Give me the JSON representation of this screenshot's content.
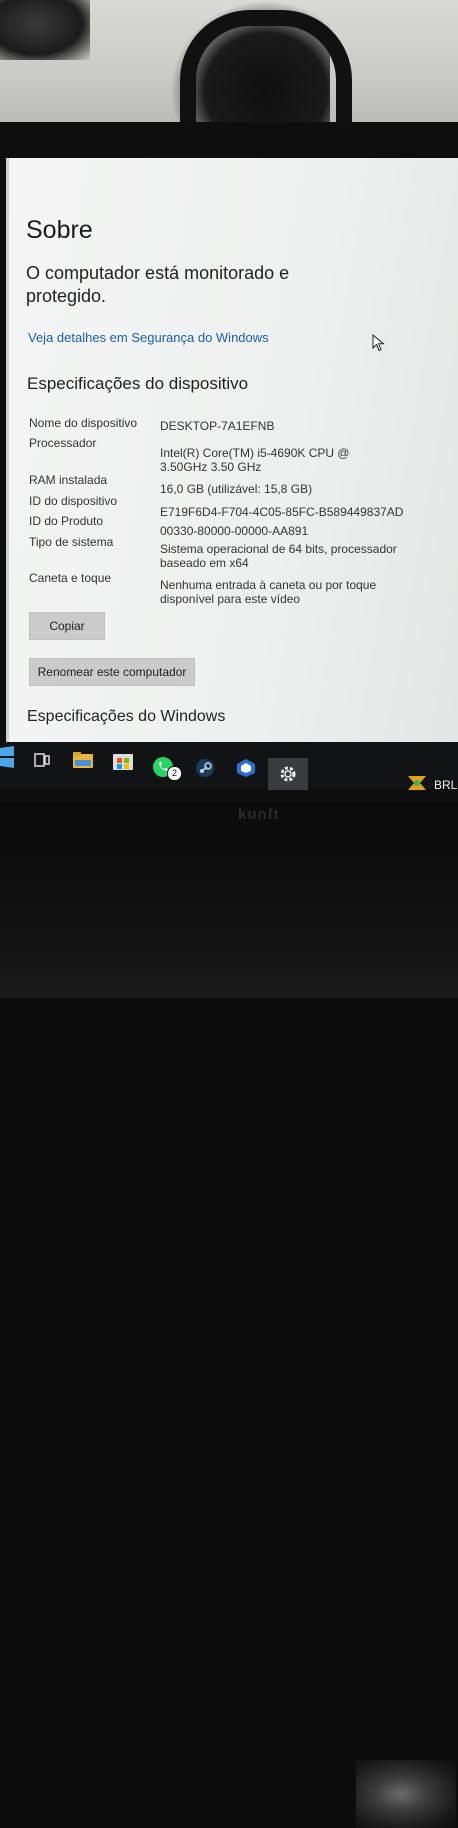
{
  "settings": {
    "title": "Sobre",
    "status_line": "O computador está monitorado e protegido.",
    "security_link": "Veja detalhes em Segurança do Windows",
    "device_specs_heading": "Especificações do dispositivo",
    "specs": [
      {
        "label": "Nome do dispositivo",
        "value": "DESKTOP-7A1EFNB"
      },
      {
        "label": "Processador",
        "value": "Intel(R) Core(TM) i5-4690K CPU @ 3.50GHz 3.50 GHz"
      },
      {
        "label": "RAM instalada",
        "value": "16,0 GB (utilizável: 15,8 GB)"
      },
      {
        "label": "ID do dispositivo",
        "value": "E719F6D4-F704-4C05-85FC-B589449837AD"
      },
      {
        "label": "ID do Produto",
        "value": "00330-80000-00000-AA891"
      },
      {
        "label": "Tipo de sistema",
        "value": "Sistema operacional de 64 bits, processador baseado em x64"
      },
      {
        "label": "Caneta e toque",
        "value": "Nenhuma entrada à caneta ou por toque disponível para este vídeo"
      }
    ],
    "copy_button": "Copiar",
    "rename_button": "Renomear este computador",
    "windows_specs_heading": "Especificações do Windows"
  },
  "taskbar": {
    "icons": [
      "start-icon",
      "task-view-icon",
      "file-explorer-icon",
      "store-icon",
      "whatsapp-icon",
      "steam-icon",
      "app-icon",
      "settings-icon"
    ],
    "whatsapp_badge": "2",
    "language": "BRL"
  },
  "monitor": {
    "brand": "kunft"
  },
  "colors": {
    "link": "#1a5fa8",
    "taskbar": "#121315",
    "button": "#cbcbcb"
  }
}
